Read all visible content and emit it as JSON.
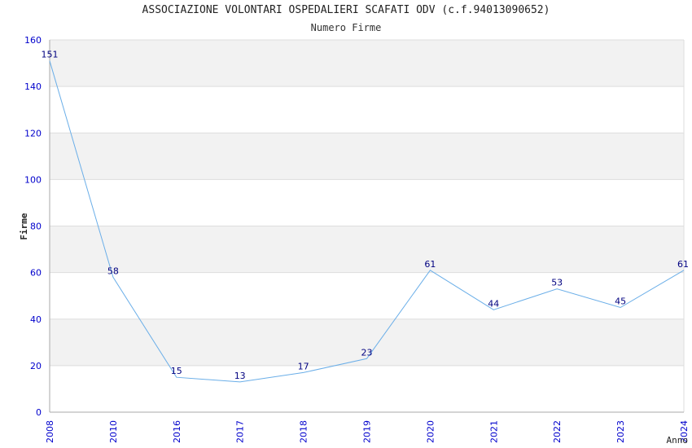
{
  "chart_data": {
    "type": "line",
    "title": "ASSOCIAZIONE VOLONTARI OSPEDALIERI SCAFATI ODV (c.f.94013090652)",
    "subtitle": "Numero Firme",
    "xlabel": "Anno",
    "ylabel": "Firme",
    "categories": [
      "2008",
      "2010",
      "2016",
      "2017",
      "2018",
      "2019",
      "2020",
      "2021",
      "2022",
      "2023",
      "2024"
    ],
    "values": [
      151,
      58,
      15,
      13,
      17,
      23,
      61,
      44,
      53,
      45,
      61
    ],
    "ylim": [
      0,
      160
    ],
    "yticks": [
      0,
      20,
      40,
      60,
      80,
      100,
      120,
      140,
      160
    ],
    "grid": true,
    "colors": {
      "line": "#6aaee8",
      "tick_text": "#0000cc",
      "data_label": "#000080",
      "band": "#f2f2f2",
      "grid": "#dddddd"
    }
  }
}
